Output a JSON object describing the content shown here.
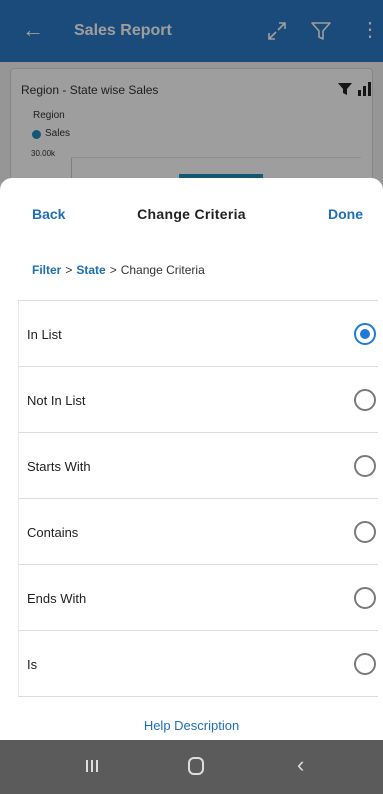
{
  "appbar": {
    "back_glyph": "←",
    "title": "Sales Report",
    "expand_icon": "expand-icon",
    "filter_icon": "filter-icon",
    "more_glyph": "⋮"
  },
  "card": {
    "title": "Region - State wise Sales",
    "region_label": "Region",
    "legend_series": "Sales",
    "axis_tick": "30.00k"
  },
  "sheet": {
    "back_label": "Back",
    "title": "Change Criteria",
    "done_label": "Done",
    "breadcrumb": {
      "filter": "Filter",
      "sep1": ">",
      "state": "State",
      "sep2": ">",
      "current": "Change Criteria"
    },
    "options": [
      {
        "label": "In List",
        "selected": true
      },
      {
        "label": "Not In List",
        "selected": false
      },
      {
        "label": "Starts With",
        "selected": false
      },
      {
        "label": "Contains",
        "selected": false
      },
      {
        "label": "Ends With",
        "selected": false
      },
      {
        "label": "Is",
        "selected": false
      }
    ],
    "help_label": "Help Description"
  },
  "colors": {
    "appbar": "#2a79c7",
    "accent": "#1d6fb6",
    "radio_selected": "#1f7ad6",
    "series": "#1f8db8",
    "navbar": "#5b5b5b"
  },
  "navbar": {
    "back_glyph": "‹"
  }
}
